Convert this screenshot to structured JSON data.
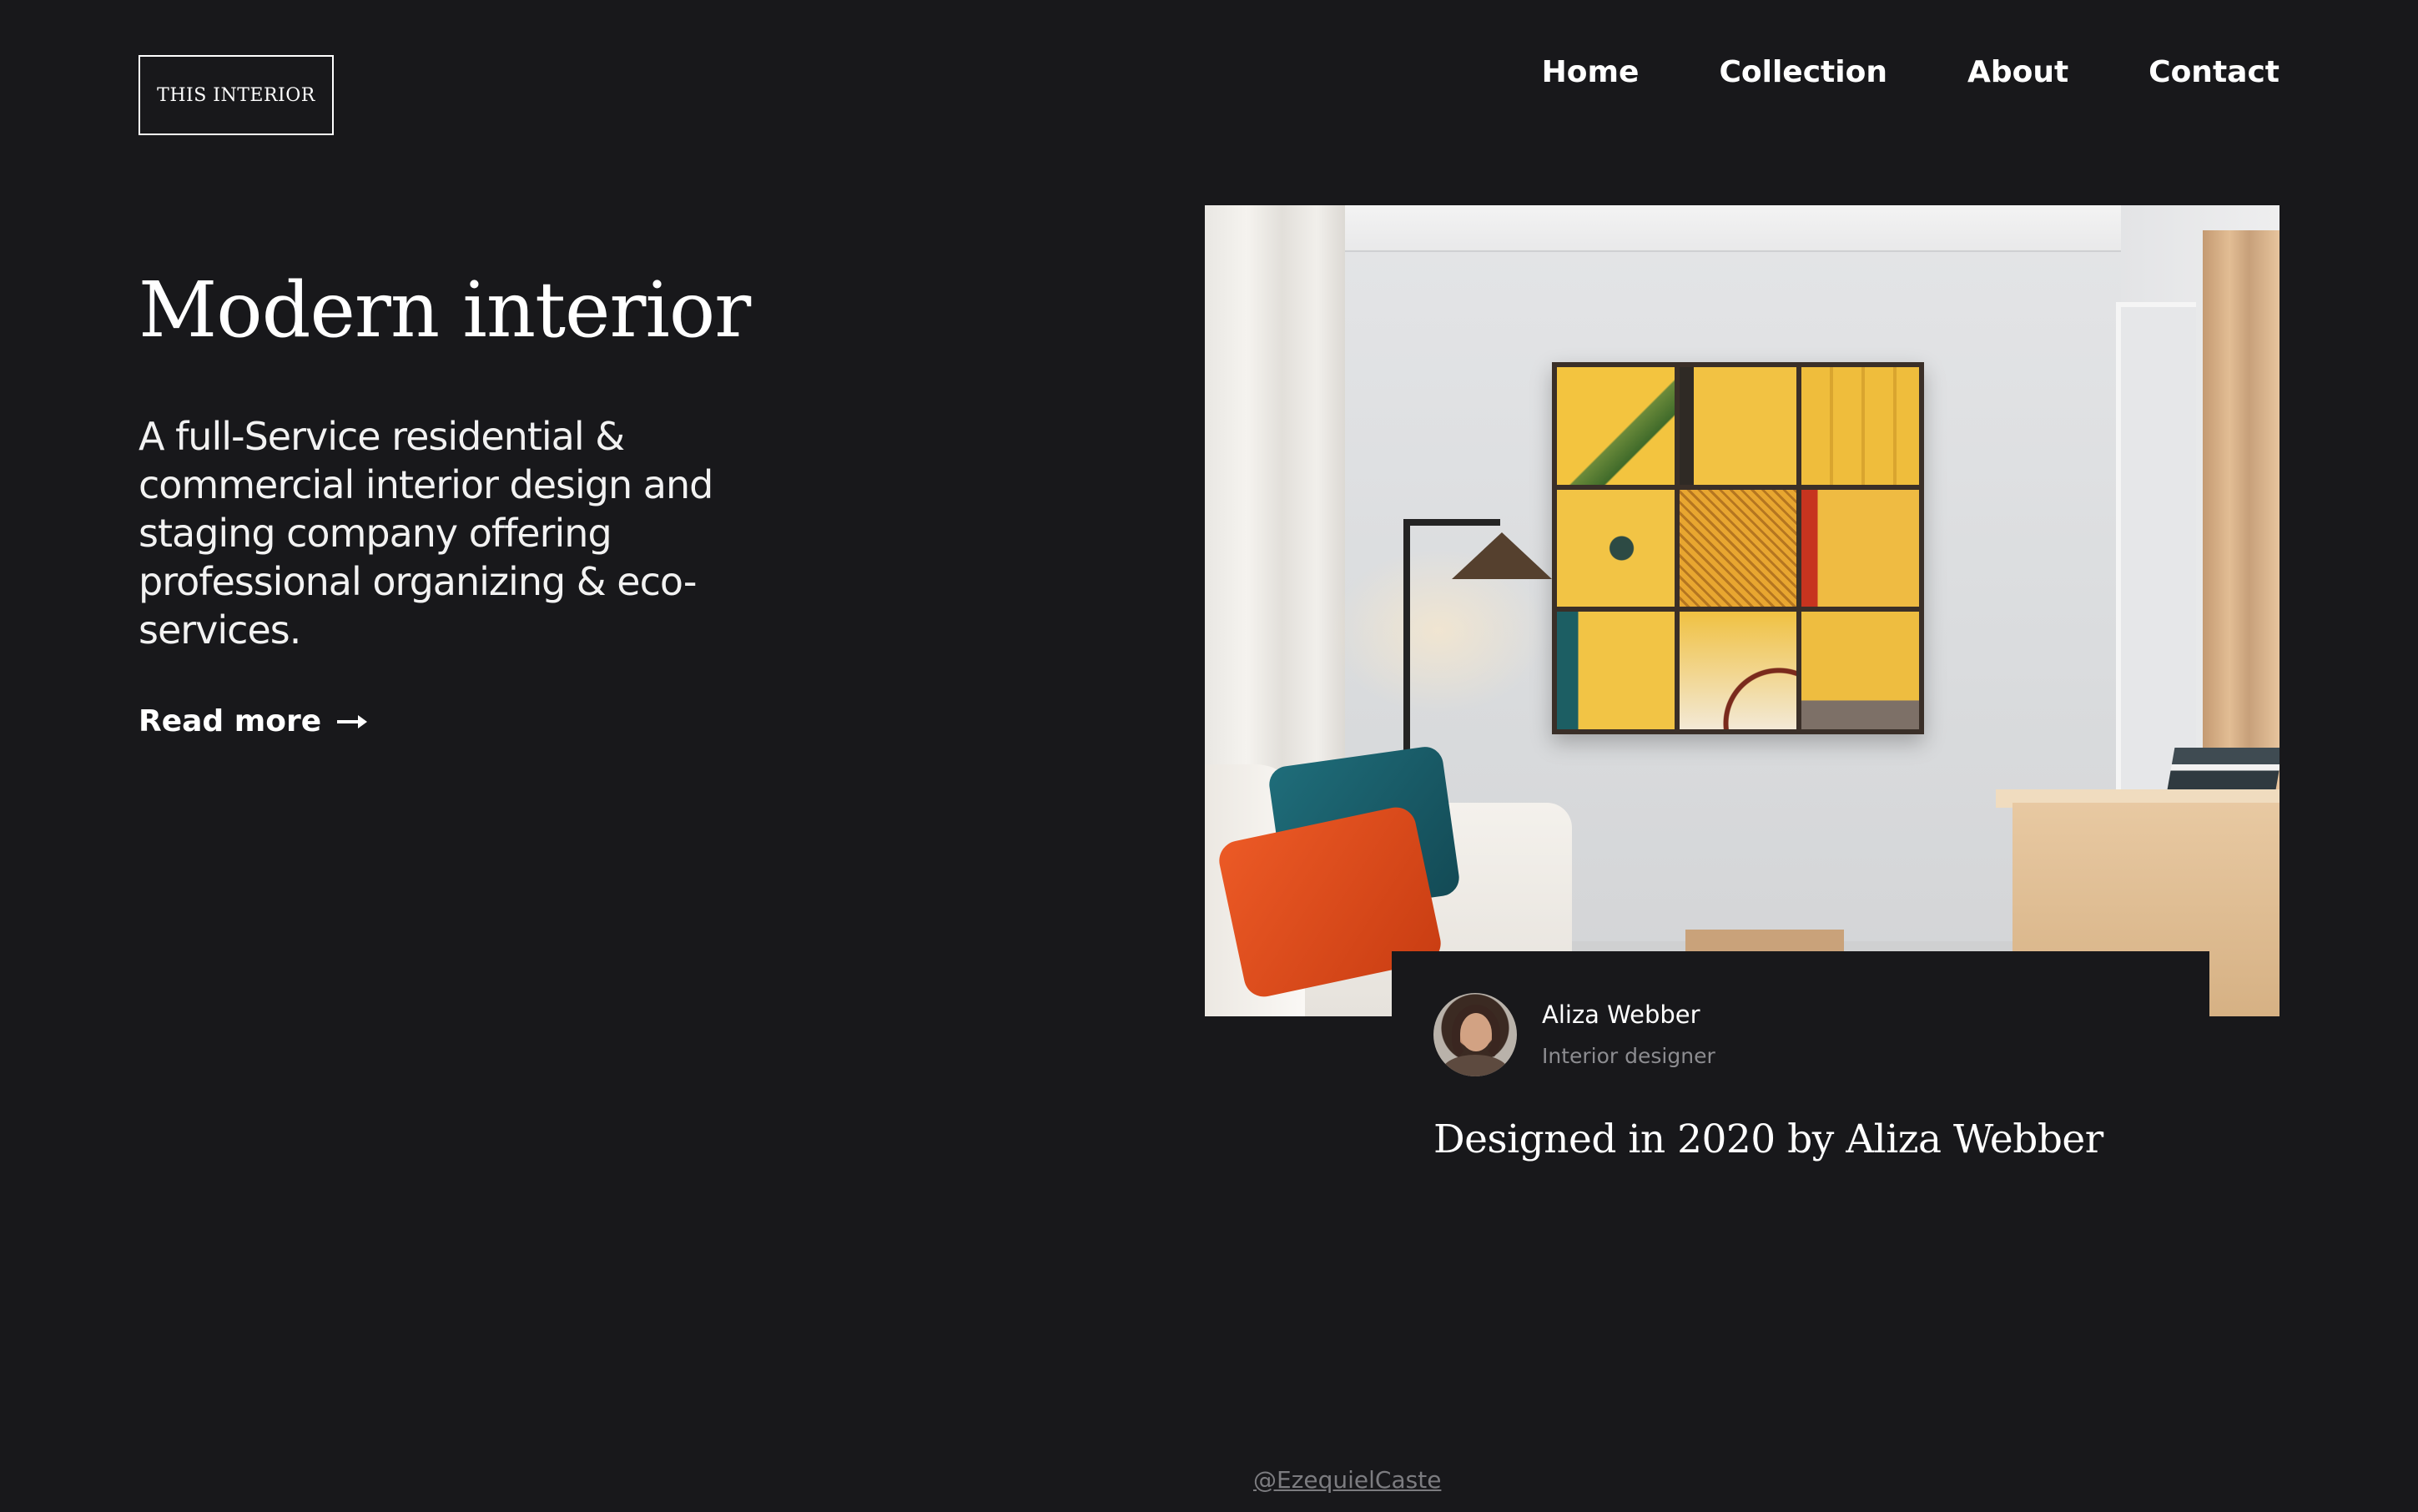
{
  "brand": {
    "logo_text": "THIS INTERIOR"
  },
  "nav": {
    "items": [
      {
        "label": "Home"
      },
      {
        "label": "Collection"
      },
      {
        "label": "About"
      },
      {
        "label": "Contact"
      }
    ]
  },
  "hero": {
    "title": "Modern interior",
    "description": "A full-Service residential & commercial interior design and staging company offering professional organizing & eco-services.",
    "cta_label": "Read more",
    "cta_icon": "arrow-right-icon"
  },
  "designer": {
    "name": "Aliza Webber",
    "role": "Interior designer",
    "caption": "Designed in 2020 by Aliza Webber"
  },
  "footer": {
    "credit": "@EzequielCaste"
  },
  "colors": {
    "background": "#18181b",
    "text": "#ffffff",
    "muted": "#8c8c90"
  }
}
